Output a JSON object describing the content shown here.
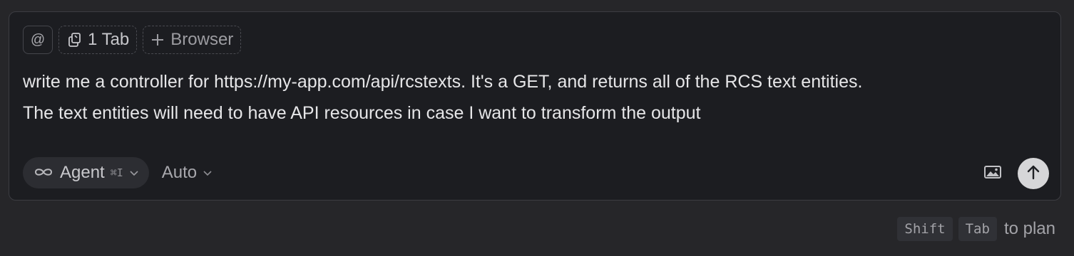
{
  "context": {
    "mention_label": "@",
    "tab_label": "1 Tab",
    "browser_label": "Browser"
  },
  "prompt": {
    "lines": [
      "write me a controller for https://my-app.com/api/rcstexts. It's a GET, and returns all of the RCS text entities.",
      "The text entities will need to have API resources in case I want to transform the output"
    ]
  },
  "toolbar": {
    "mode_label": "Agent",
    "mode_shortcut": "⌘I",
    "model_label": "Auto"
  },
  "hint": {
    "key1": "Shift",
    "key2": "Tab",
    "text": "to plan"
  },
  "icons": {
    "mode": "infinity-icon",
    "tab": "tab-copy-icon",
    "browser": "plus-icon",
    "image": "image-icon",
    "send": "arrow-up-icon"
  }
}
